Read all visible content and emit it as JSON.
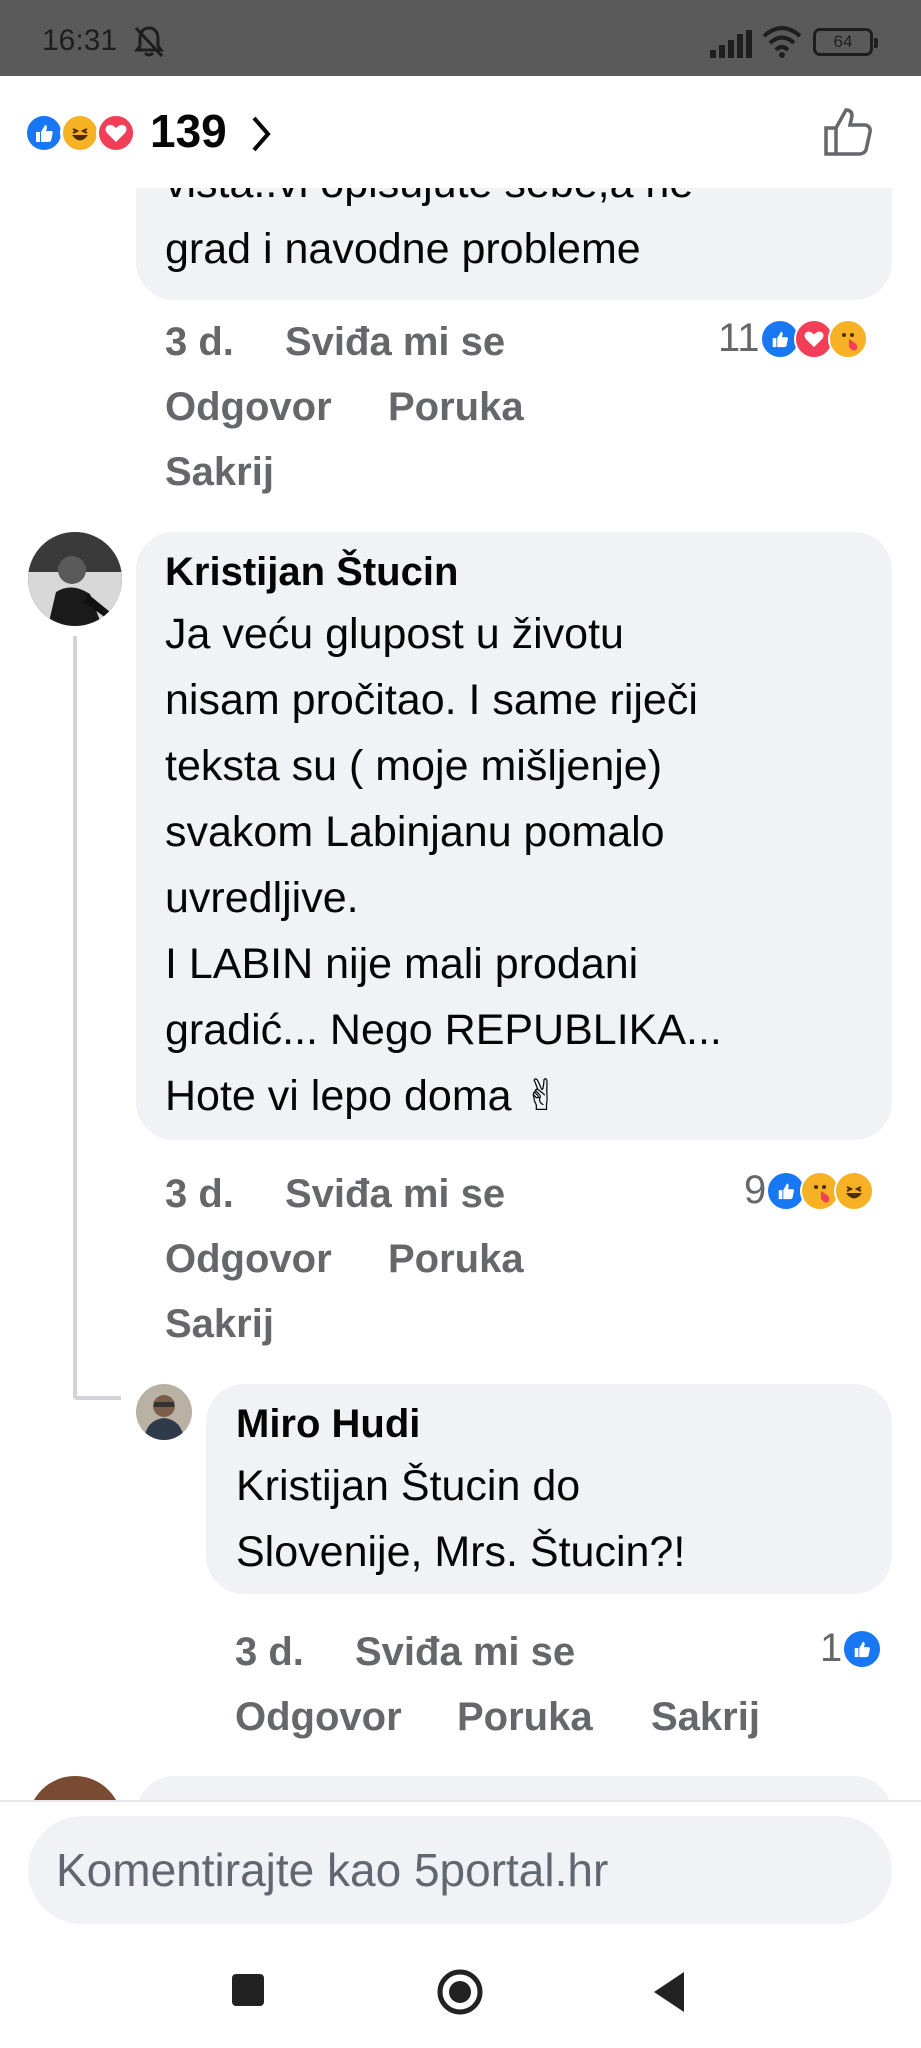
{
  "status_bar": {
    "time": "16:31",
    "battery": "64"
  },
  "header": {
    "reaction_count": "139"
  },
  "comments": [
    {
      "text": "vista..vi opisujute sebe,a ne\ngrad i navodne probleme",
      "time": "3 d.",
      "like": "Sviđa mi se",
      "reply": "Odgovor",
      "message": "Poruka",
      "hide": "Sakrij",
      "reaction_count": "11"
    },
    {
      "author": "Kristijan Štucin",
      "text": "Ja veću glupost u životu\nnisam pročitao. I same riječi\nteksta su ( moje mišljenje)\nsvakom Labinjanu pomalo\nuvredljive.\nI LABIN nije mali prodani\ngradić... Nego REPUBLIKA...\nHote vi lepo doma ✌",
      "time": "3 d.",
      "like": "Sviđa mi se",
      "reply": "Odgovor",
      "message": "Poruka",
      "hide": "Sakrij",
      "reaction_count": "9"
    },
    {
      "author": "Miro Hudi",
      "text": "Kristijan Štucin do\nSlovenije, Mrs. Štucin?!",
      "time": "3 d.",
      "like": "Sviđa mi se",
      "reply": "Odgovor",
      "message": "Poruka",
      "hide": "Sakrij",
      "reaction_count": "1"
    }
  ],
  "composer": {
    "placeholder": "Komentirajte kao 5portal.hr"
  },
  "icons": {
    "like": "like-reaction-icon",
    "haha": "haha-reaction-icon",
    "love": "love-reaction-icon",
    "care": "care-reaction-icon"
  },
  "colors": {
    "like_blue": "#1877f2",
    "love_red": "#f33e58",
    "haha_yellow": "#f7b125",
    "meta_gray": "#65676b",
    "bubble_bg": "#f0f2f5"
  }
}
